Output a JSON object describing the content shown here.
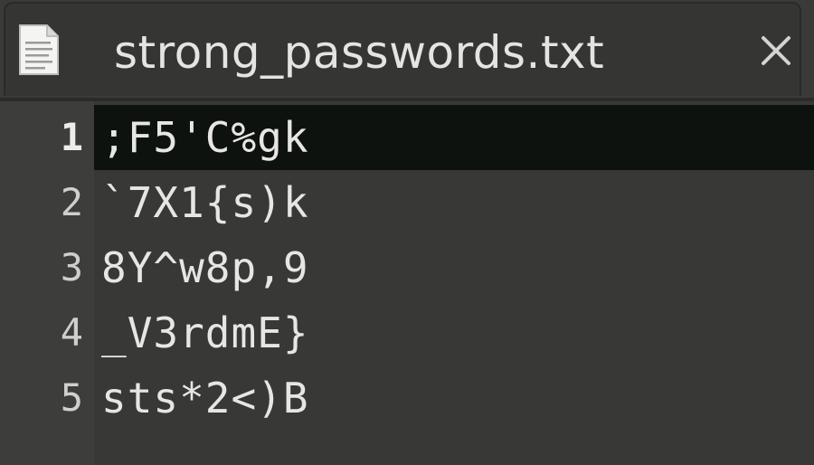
{
  "tab": {
    "title": "strong_passwords.txt",
    "icon": "text-file-icon",
    "close_icon": "close-icon"
  },
  "editor": {
    "current_line": 1,
    "lines": [
      {
        "number": "1",
        "text": ";F5'C%gk"
      },
      {
        "number": "2",
        "text": "`7X1{s)k"
      },
      {
        "number": "3",
        "text": "8Y^w8p,9"
      },
      {
        "number": "4",
        "text": "_V3rdmE}"
      },
      {
        "number": "5",
        "text": "sts*2<)B"
      }
    ]
  },
  "colors": {
    "background": "#3b3b3a",
    "current_line_highlight": "#0e120e",
    "text": "#e6e6e3"
  }
}
